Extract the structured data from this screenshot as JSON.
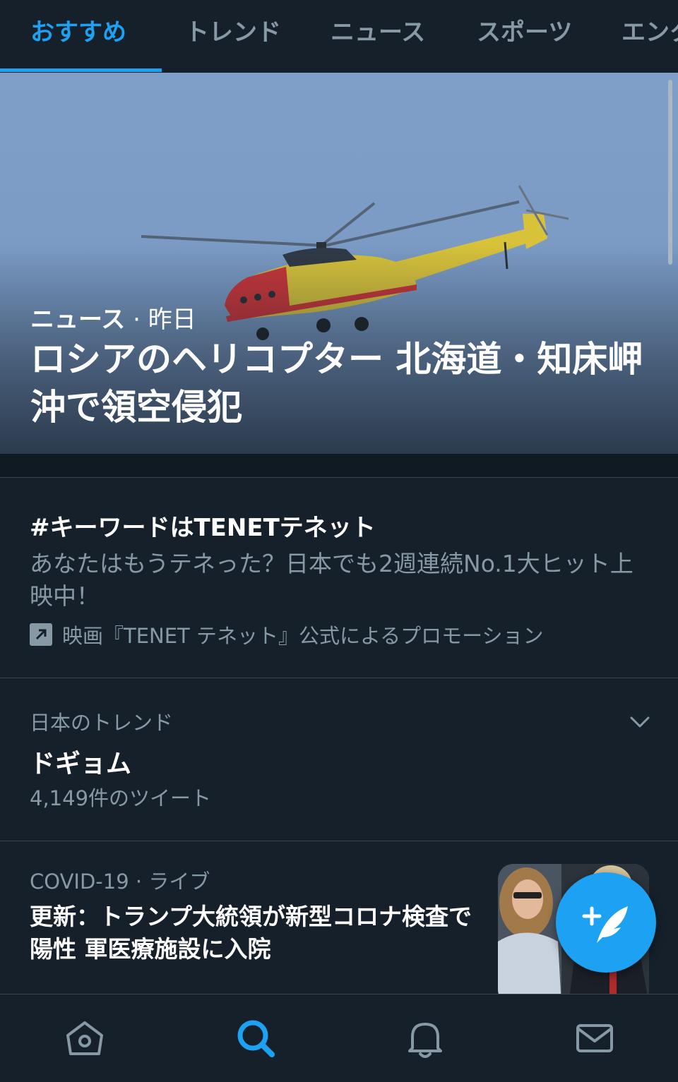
{
  "tabs": [
    {
      "label": "おすすめ",
      "active": true
    },
    {
      "label": "トレンド",
      "active": false
    },
    {
      "label": "ニュース",
      "active": false
    },
    {
      "label": "スポーツ",
      "active": false
    },
    {
      "label": "エンタ",
      "active": false
    }
  ],
  "hero": {
    "category": "ニュース",
    "separator": " · ",
    "time": "昨日",
    "title": "ロシアのヘリコプター 北海道・知床岬沖で領空侵犯"
  },
  "promoted": {
    "title": "#キーワードはTENETテネット",
    "description": "あなたはもうテネった？日本でも2週連続No.1大ヒット上映中！",
    "promoter": "映画『TENET テネット』公式によるプロモーション",
    "icon": "promoted-arrow-icon"
  },
  "trend": {
    "context": "日本のトレンド",
    "name": "ドギョム",
    "count": "4,149件のツイート",
    "more_icon": "chevron-down-icon"
  },
  "news": {
    "category": "COVID-19",
    "separator": " · ",
    "status": "ライブ",
    "title": "更新：トランプ大統領が新型コロナ検査で陽性 軍医療施設に入院"
  },
  "fab": {
    "icon": "compose-tweet-icon"
  },
  "bottom_nav": [
    {
      "icon": "home-icon",
      "active": false
    },
    {
      "icon": "search-icon",
      "active": true
    },
    {
      "icon": "notifications-icon",
      "active": false
    },
    {
      "icon": "messages-icon",
      "active": false
    }
  ],
  "colors": {
    "background": "#15202b",
    "accent": "#1da1f2",
    "secondary_text": "#8899a6",
    "divider": "#38444d"
  }
}
